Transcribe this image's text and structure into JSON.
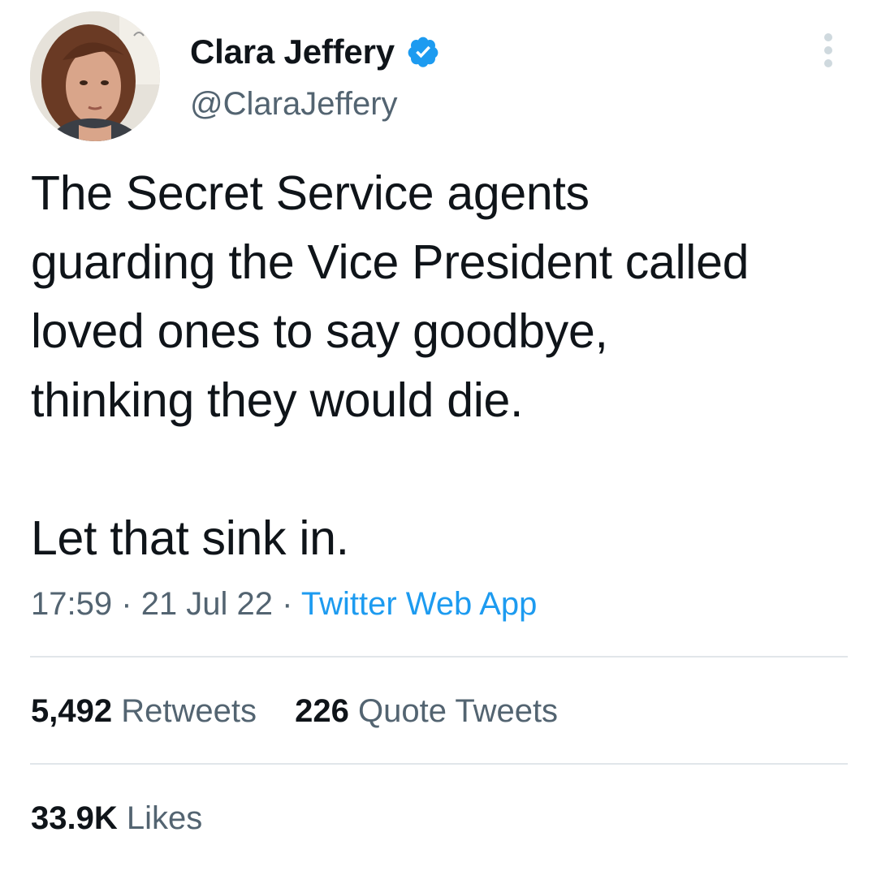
{
  "author": {
    "display_name": "Clara Jeffery",
    "handle": "@ClaraJeffery",
    "verified": true,
    "avatar_icon": "profile-photo"
  },
  "tweet": {
    "text": "The Secret Service agents\nguarding the Vice President called\nloved ones to say goodbye,\nthinking they would die.\n\nLet that sink in.",
    "time": "17:59",
    "separator": "·",
    "date": "21 Jul 22",
    "source": "Twitter Web App"
  },
  "stats": {
    "retweets_count": "5,492",
    "retweets_label": "Retweets",
    "quotes_count": "226",
    "quotes_label": "Quote Tweets",
    "likes_count": "33.9K",
    "likes_label": "Likes"
  },
  "colors": {
    "text_primary": "#0f1419",
    "text_secondary": "#536471",
    "accent": "#1d9bf0",
    "divider": "#e1e6ea",
    "background": "#ffffff"
  },
  "icons": {
    "verified": "verified-badge-icon",
    "more": "more-options-icon"
  }
}
